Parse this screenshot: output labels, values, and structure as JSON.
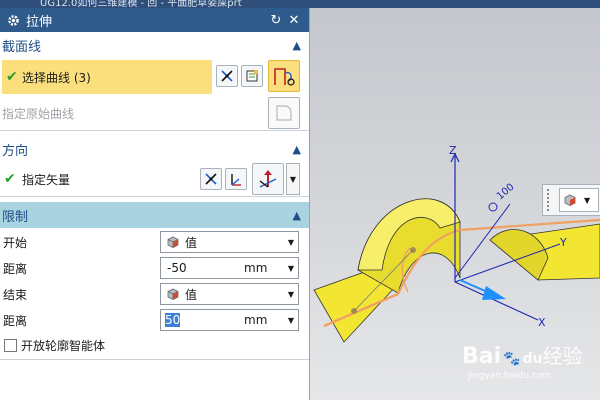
{
  "window_title_fragment": "UG12.0如何三维建模 - 回 - 平面肥草姿屎prt",
  "dialog": {
    "title": "拉伸",
    "title_buttons": [
      "reset",
      "close"
    ],
    "sections": {
      "section_curve": {
        "title": "截面线",
        "select_curve_label": "选择曲线 (3)",
        "original_curve_label": "指定原始曲线"
      },
      "direction": {
        "title": "方向",
        "vector_label": "指定矢量"
      },
      "limits": {
        "title": "限制",
        "start_label": "开始",
        "start_value": "值",
        "distance1_label": "距离",
        "distance1_value": "-50",
        "distance1_unit": "mm",
        "end_label": "结束",
        "end_value": "值",
        "distance2_label": "距离",
        "distance2_value": "50",
        "distance2_unit": "mm",
        "open_profile_label": "开放轮廓智能体",
        "open_profile_checked": false
      }
    }
  },
  "viewport": {
    "axis_labels": {
      "z": "Z",
      "x": "X",
      "y": "Y"
    },
    "dimension_label": "100",
    "colors": {
      "solid": "#f2e632",
      "curve": "#f0a060",
      "axis": "#1e28b4",
      "arrow": "#1e90ff"
    }
  },
  "watermark": {
    "brand": "Bai",
    "paw": "du",
    "cn": "经验",
    "url": "jingyan.baidu.com"
  }
}
